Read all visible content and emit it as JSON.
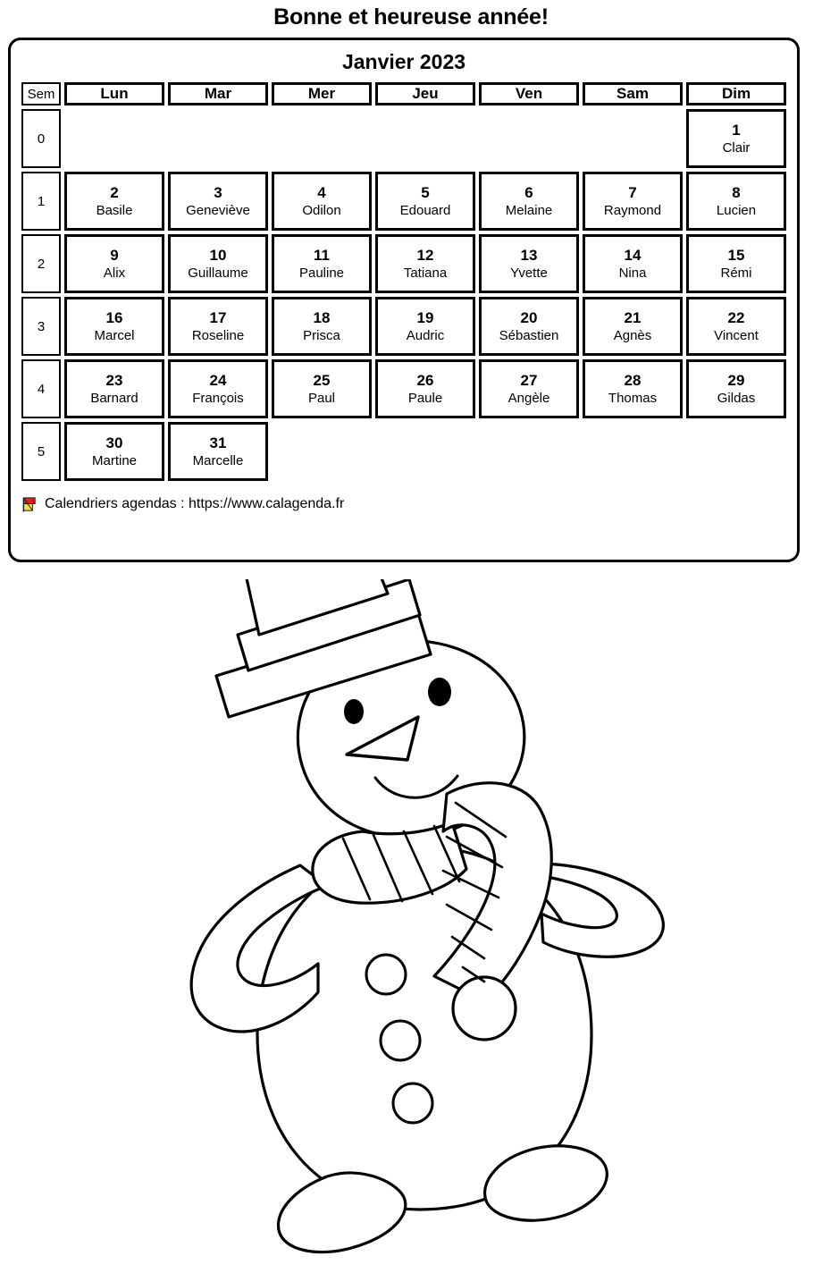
{
  "greeting": "Bonne et heureuse année!",
  "calendar": {
    "title": "Janvier 2023",
    "week_header": "Sem",
    "day_headers": [
      "Lun",
      "Mar",
      "Mer",
      "Jeu",
      "Ven",
      "Sam",
      "Dim"
    ],
    "weeks": [
      {
        "week": "0",
        "days": [
          {
            "num": "",
            "name": "",
            "empty": true
          },
          {
            "num": "",
            "name": "",
            "empty": true
          },
          {
            "num": "",
            "name": "",
            "empty": true
          },
          {
            "num": "",
            "name": "",
            "empty": true
          },
          {
            "num": "",
            "name": "",
            "empty": true
          },
          {
            "num": "",
            "name": "",
            "empty": true
          },
          {
            "num": "1",
            "name": "Clair",
            "empty": false
          }
        ]
      },
      {
        "week": "1",
        "days": [
          {
            "num": "2",
            "name": "Basile",
            "empty": false
          },
          {
            "num": "3",
            "name": "Geneviève",
            "empty": false
          },
          {
            "num": "4",
            "name": "Odilon",
            "empty": false
          },
          {
            "num": "5",
            "name": "Edouard",
            "empty": false
          },
          {
            "num": "6",
            "name": "Melaine",
            "empty": false
          },
          {
            "num": "7",
            "name": "Raymond",
            "empty": false
          },
          {
            "num": "8",
            "name": "Lucien",
            "empty": false
          }
        ]
      },
      {
        "week": "2",
        "days": [
          {
            "num": "9",
            "name": "Alix",
            "empty": false
          },
          {
            "num": "10",
            "name": "Guillaume",
            "empty": false
          },
          {
            "num": "11",
            "name": "Pauline",
            "empty": false
          },
          {
            "num": "12",
            "name": "Tatiana",
            "empty": false
          },
          {
            "num": "13",
            "name": "Yvette",
            "empty": false
          },
          {
            "num": "14",
            "name": "Nina",
            "empty": false
          },
          {
            "num": "15",
            "name": "Rémi",
            "empty": false
          }
        ]
      },
      {
        "week": "3",
        "days": [
          {
            "num": "16",
            "name": "Marcel",
            "empty": false
          },
          {
            "num": "17",
            "name": "Roseline",
            "empty": false
          },
          {
            "num": "18",
            "name": "Prisca",
            "empty": false
          },
          {
            "num": "19",
            "name": "Audric",
            "empty": false
          },
          {
            "num": "20",
            "name": "Sébastien",
            "empty": false
          },
          {
            "num": "21",
            "name": "Agnès",
            "empty": false
          },
          {
            "num": "22",
            "name": "Vincent",
            "empty": false
          }
        ]
      },
      {
        "week": "4",
        "days": [
          {
            "num": "23",
            "name": "Barnard",
            "empty": false
          },
          {
            "num": "24",
            "name": "François",
            "empty": false
          },
          {
            "num": "25",
            "name": "Paul",
            "empty": false
          },
          {
            "num": "26",
            "name": "Paule",
            "empty": false
          },
          {
            "num": "27",
            "name": "Angèle",
            "empty": false
          },
          {
            "num": "28",
            "name": "Thomas",
            "empty": false
          },
          {
            "num": "29",
            "name": "Gildas",
            "empty": false
          }
        ]
      },
      {
        "week": "5",
        "days": [
          {
            "num": "30",
            "name": "Martine",
            "empty": false
          },
          {
            "num": "31",
            "name": "Marcelle",
            "empty": false
          },
          {
            "num": "",
            "name": "",
            "empty": true
          },
          {
            "num": "",
            "name": "",
            "empty": true
          },
          {
            "num": "",
            "name": "",
            "empty": true
          },
          {
            "num": "",
            "name": "",
            "empty": true
          },
          {
            "num": "",
            "name": "",
            "empty": true
          }
        ]
      }
    ],
    "footer": {
      "logo_icon": "calagenda-flag-logo-icon",
      "text": "Calendriers agendas : https://www.calagenda.fr",
      "logo_colors": {
        "red": "#e8201c",
        "yellow": "#f5e13c",
        "outline": "#1a1a1a"
      }
    }
  },
  "illustration": {
    "name": "snowman-coloring-illustration",
    "description": "Line-art snowman with top hat, carrot nose, striped scarf, three buttons, two arms and two feet",
    "stroke_color": "#000000",
    "fill_color": "#ffffff"
  }
}
